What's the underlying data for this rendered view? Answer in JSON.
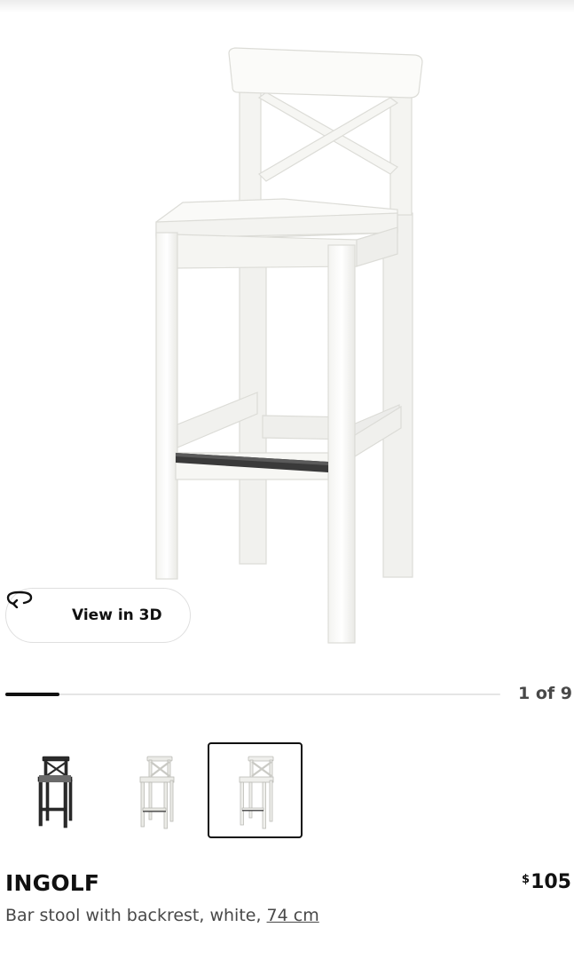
{
  "gallery": {
    "view_3d_label": "View in 3D",
    "view_3d_icon": "rotate-3d-icon",
    "counter_text": "1 of 9",
    "current_index": 1,
    "total_images": 9,
    "progress_fraction": 0.11
  },
  "thumbnails": [
    {
      "name": "black-bar-stool-thumbnail",
      "color": "#2b2b2b",
      "selected": false
    },
    {
      "name": "white-bar-stool-angle-thumbnail",
      "color": "#e8e8e4",
      "selected": false
    },
    {
      "name": "white-bar-stool-front-thumbnail",
      "color": "#efefec",
      "selected": true
    }
  ],
  "product": {
    "name": "INGOLF",
    "price_currency": "$",
    "price_amount": "105",
    "description_prefix": "Bar stool with backrest, white, ",
    "size_link": "74 cm"
  },
  "colors": {
    "text_primary": "#111111",
    "text_secondary": "#484848",
    "border": "#dfdfdf"
  }
}
